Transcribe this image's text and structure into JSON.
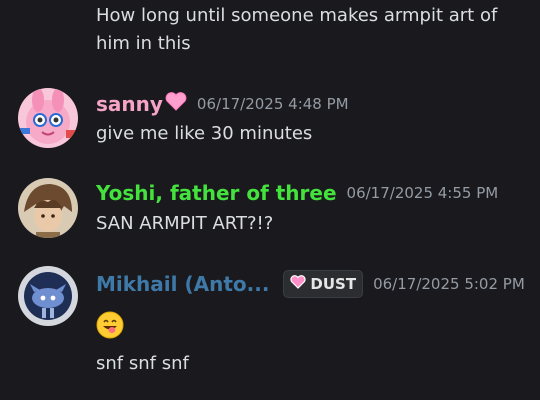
{
  "messages": [
    {
      "text_lines": [
        "How long until someone makes armpit art of",
        "him in this"
      ]
    },
    {
      "username": "sanny",
      "username_color": "#f6a3c8",
      "suffix_icon": "heart-icon",
      "timestamp": "06/17/2025 4:48 PM",
      "text": "give me like 30 minutes",
      "avatar_icon": "pink-bunny-avatar"
    },
    {
      "username": "Yoshi, father of three",
      "username_color": "#44e23c",
      "timestamp": "06/17/2025 4:55 PM",
      "text": "SAN ARMPIT ART?!?",
      "avatar_icon": "brown-hair-character-avatar"
    },
    {
      "username": "Mikhail (Anto...",
      "username_color": "#3e79a8",
      "tag": {
        "icon": "heart-badge-icon",
        "label": "DUST"
      },
      "timestamp": "06/17/2025 5:02 PM",
      "emoji": "grinning-tongue-emoji",
      "text": "snf snf snf",
      "avatar_icon": "blue-creature-avatar"
    }
  ]
}
